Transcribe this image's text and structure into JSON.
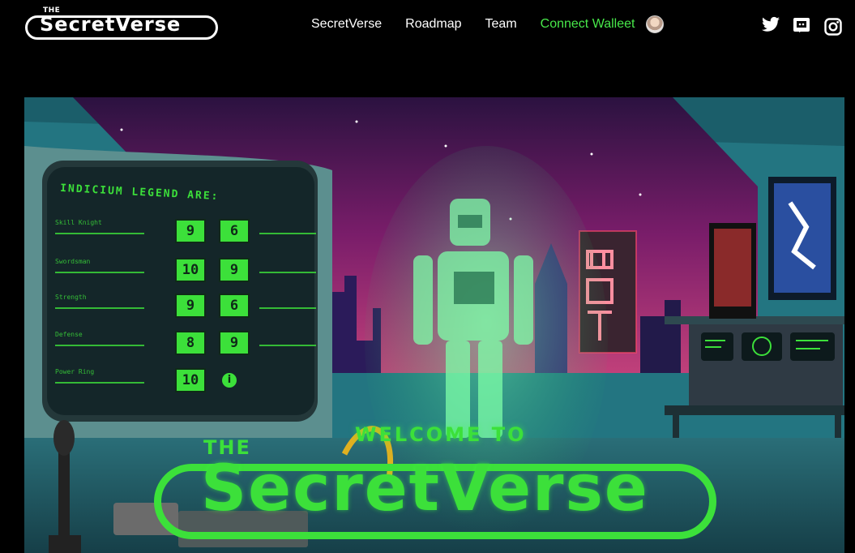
{
  "header": {
    "logo": {
      "small": "THE",
      "word": "SecretVerse"
    },
    "nav": [
      {
        "label": "SecretVerse"
      },
      {
        "label": "Roadmap"
      },
      {
        "label": "Team"
      },
      {
        "label": "Connect Walleet",
        "accent": "#48e84a"
      }
    ],
    "social": [
      {
        "icon": "twitter-icon"
      },
      {
        "icon": "discord-icon"
      },
      {
        "icon": "instagram-icon"
      }
    ]
  },
  "hero": {
    "welcome": "WELCOME TO",
    "the": "THE",
    "title": "SecretVerse",
    "accent_color": "#3ce03a",
    "monitor": {
      "heading": "INDICIUM LEGEND ARE:",
      "rows": [
        {
          "label": "Skill Knight",
          "left": "9",
          "right": "6"
        },
        {
          "label": "Swordsman",
          "left": "10",
          "right": "9"
        },
        {
          "label": "Strength",
          "left": "9",
          "right": "6"
        },
        {
          "label": "Defense",
          "left": "8",
          "right": "9"
        },
        {
          "label": "Power Ring",
          "left": "10",
          "right": "i"
        }
      ]
    },
    "neon_sign": "MOT"
  }
}
